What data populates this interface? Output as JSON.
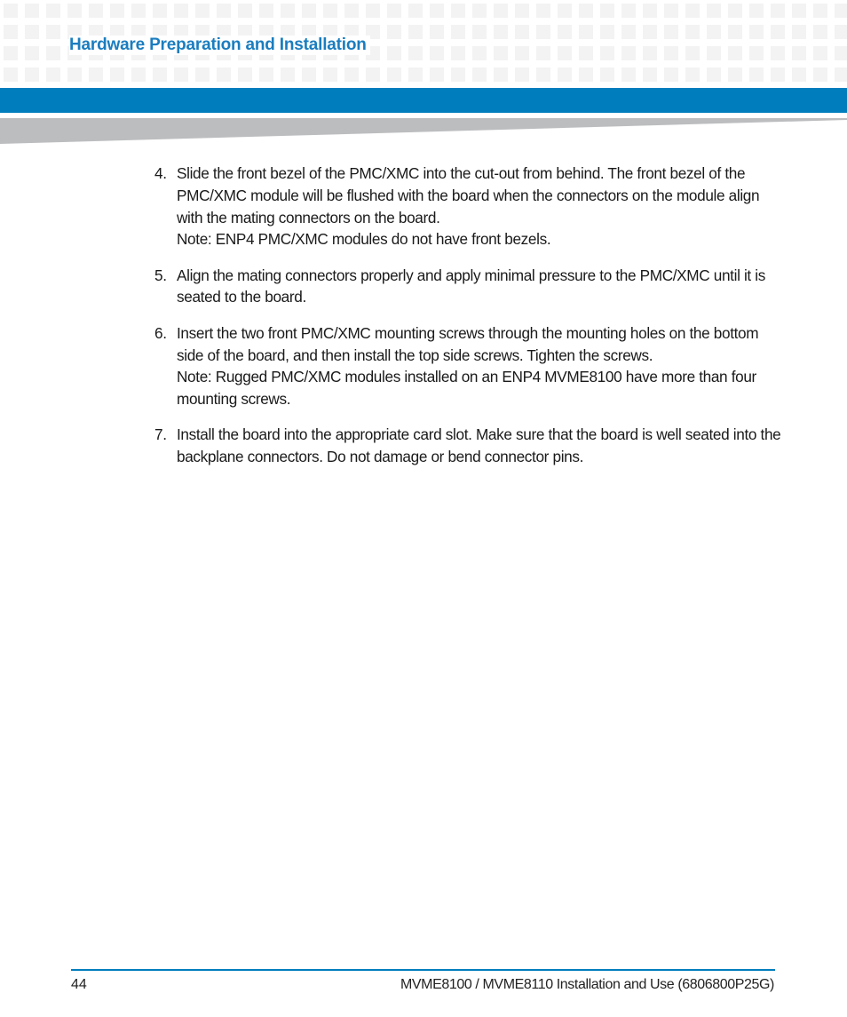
{
  "header": {
    "section_title": "Hardware Preparation and Installation",
    "accent_color": "#007dbd"
  },
  "steps": [
    {
      "number": "4.",
      "paragraphs": [
        "Slide the front bezel of the PMC/XMC into the cut-out from behind. The front bezel of the PMC/XMC module will be flushed with the board when the connectors on the module align with the mating connectors on the board.",
        "Note: ENP4 PMC/XMC modules do not have front bezels."
      ]
    },
    {
      "number": "5.",
      "paragraphs": [
        "Align the mating connectors properly and apply minimal pressure to the PMC/XMC until it is seated to the board."
      ]
    },
    {
      "number": "6.",
      "paragraphs": [
        "Insert the two front PMC/XMC mounting screws through the mounting holes on the bottom side of the board, and then install the top side screws. Tighten the screws.",
        "Note: Rugged PMC/XMC modules installed on an ENP4 MVME8100 have more than four mounting screws."
      ]
    },
    {
      "number": "7.",
      "paragraphs": [
        "Install the board into the appropriate card slot. Make sure that the board is well seated into the backplane connectors. Do not damage or bend connector pins."
      ]
    }
  ],
  "footer": {
    "page_number": "44",
    "document_title": "MVME8100 / MVME8110 Installation and Use (6806800P25G)"
  }
}
